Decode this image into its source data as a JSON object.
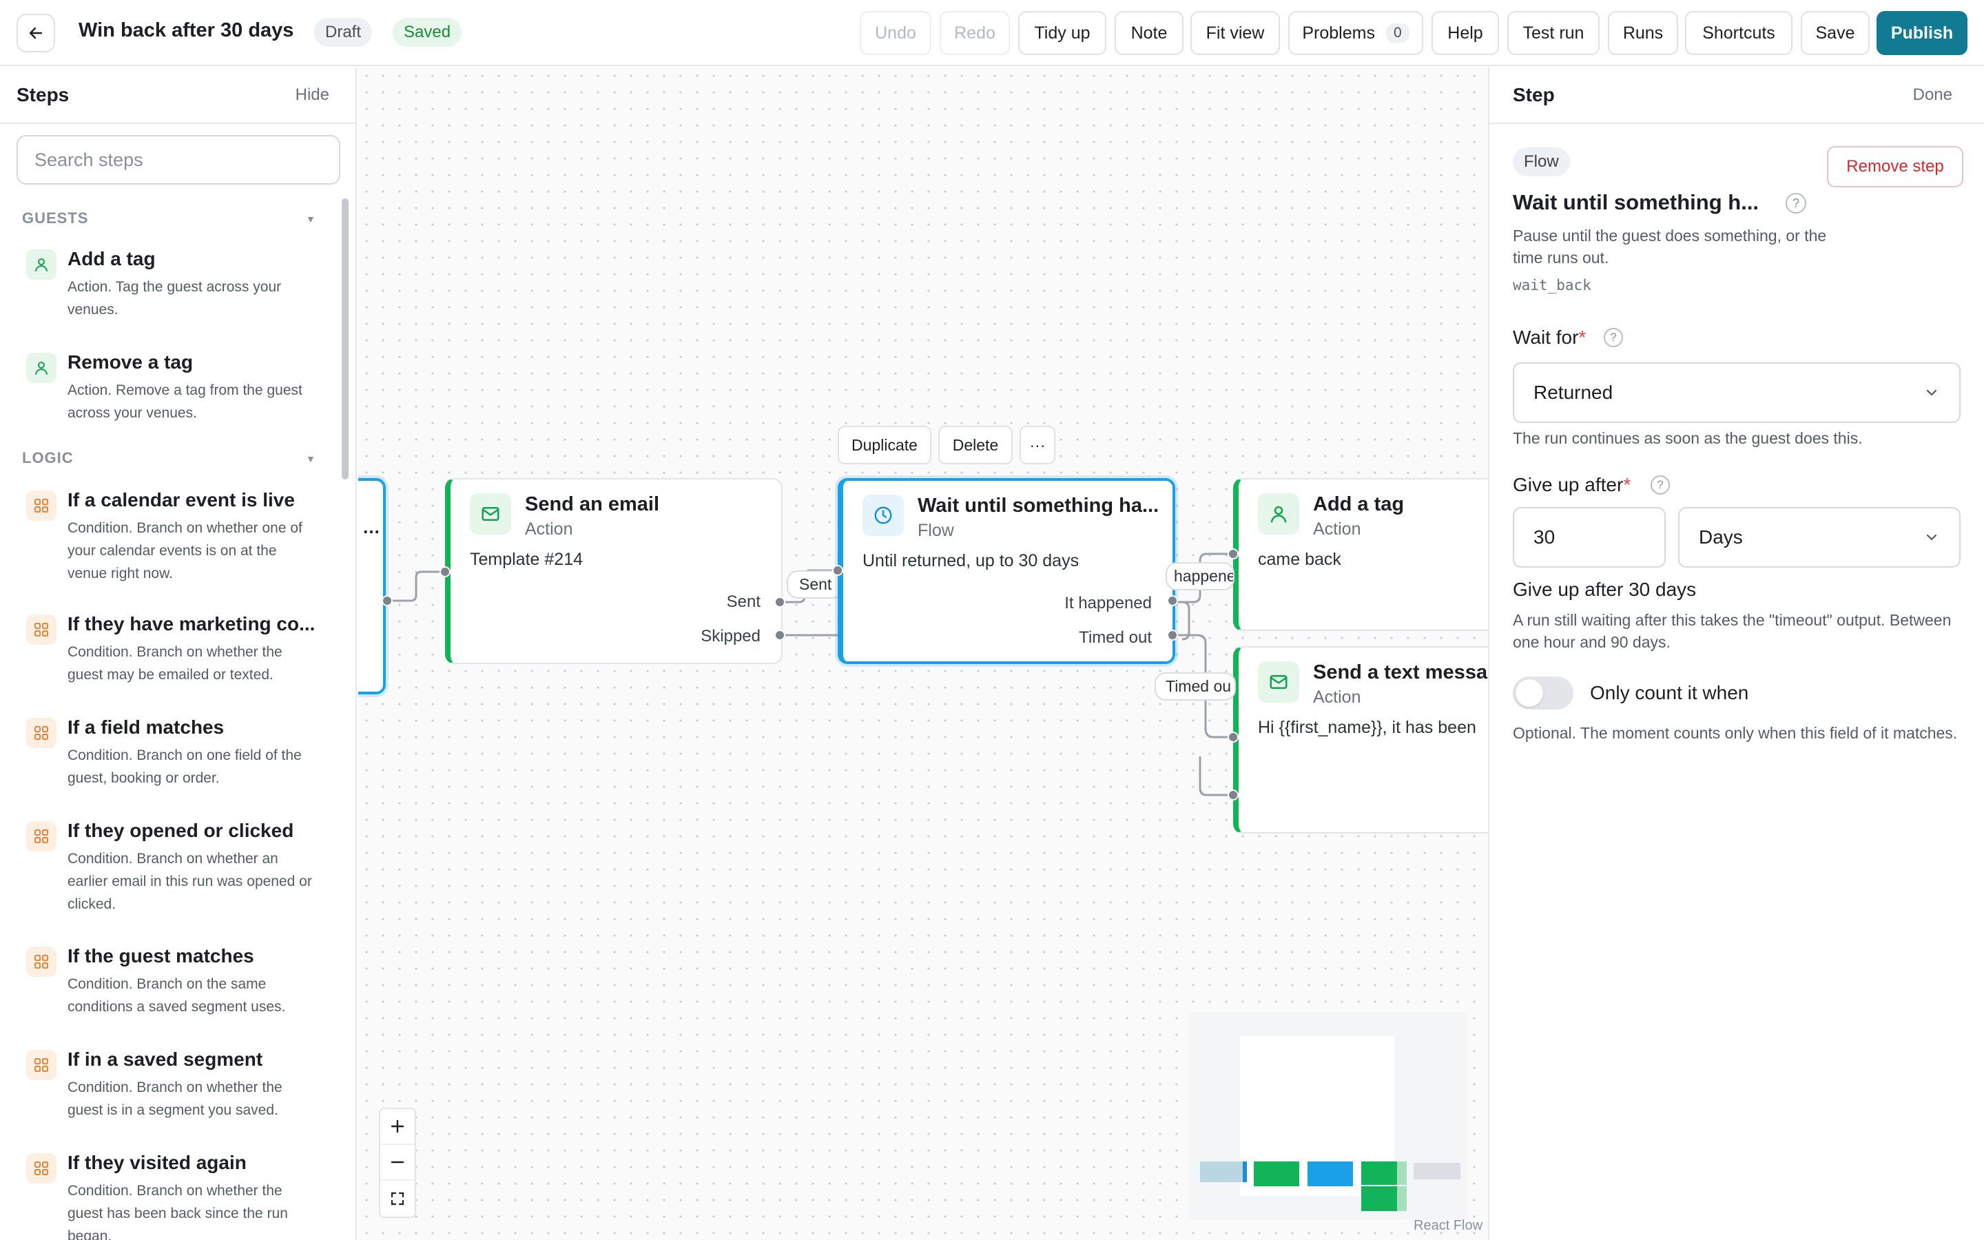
{
  "header": {
    "title": "Win back after 30 days",
    "status_draft": "Draft",
    "status_saved": "Saved",
    "buttons": {
      "undo": "Undo",
      "redo": "Redo",
      "tidy": "Tidy up",
      "note": "Note",
      "fit": "Fit view",
      "problems": "Problems",
      "problems_count": "0",
      "help": "Help",
      "test_run": "Test run",
      "runs": "Runs",
      "shortcuts": "Shortcuts",
      "save": "Save",
      "publish": "Publish"
    }
  },
  "sidebar": {
    "title": "Steps",
    "hide": "Hide",
    "search_placeholder": "Search steps",
    "sections": [
      {
        "label": "GUESTS",
        "items": [
          {
            "name": "Add a tag",
            "desc": "Action. Tag the guest across your venues."
          },
          {
            "name": "Remove a tag",
            "desc": "Action. Remove a tag from the guest across your venues."
          }
        ]
      },
      {
        "label": "LOGIC",
        "items": [
          {
            "name": "If a calendar event is live",
            "desc": "Condition. Branch on whether one of your calendar events is on at the venue right now."
          },
          {
            "name": "If they have marketing co...",
            "desc": "Condition. Branch on whether the guest may be emailed or texted."
          },
          {
            "name": "If a field matches",
            "desc": "Condition. Branch on one field of the guest, booking or order."
          },
          {
            "name": "If they opened or clicked",
            "desc": "Condition. Branch on whether an earlier email in this run was opened or clicked."
          },
          {
            "name": "If the guest matches",
            "desc": "Condition. Branch on the same conditions a saved segment uses."
          },
          {
            "name": "If in a saved segment",
            "desc": "Condition. Branch on whether the guest is in a segment you saved."
          },
          {
            "name": "If they visited again",
            "desc": "Condition. Branch on whether the guest has been back since the run began."
          }
        ]
      }
    ]
  },
  "canvas": {
    "toolbar": {
      "duplicate": "Duplicate",
      "delete": "Delete",
      "more": "···"
    },
    "nodes": {
      "email": {
        "title": "Send an email",
        "kind": "Action",
        "body": "Template #214",
        "port_sent": "Sent",
        "port_skipped": "Skipped"
      },
      "wait": {
        "title": "Wait until something ha...",
        "kind": "Flow",
        "body": "Until returned, up to 30 days",
        "port_happened": "It happened",
        "port_timeout": "Timed out"
      },
      "tag": {
        "title": "Add a tag",
        "kind": "Action",
        "body": "came back"
      },
      "sms": {
        "title": "Send a text messag",
        "kind": "Action",
        "body": "Hi {{first_name}}, it has been"
      }
    },
    "edge_labels": {
      "sent": "Sent",
      "happened": "happened",
      "timed_out": "Timed ou"
    },
    "attribution": "React Flow"
  },
  "panel": {
    "title": "Step",
    "done": "Done",
    "badge": "Flow",
    "remove": "Remove step",
    "step_title": "Wait until something h...",
    "desc": "Pause until the guest does something, or the time runs out.",
    "code": "wait_back",
    "wait_for_label": "Wait for",
    "wait_for_value": "Returned",
    "wait_for_hint": "The run continues as soon as the guest does this.",
    "give_up_label": "Give up after",
    "give_up_value": "30",
    "give_up_unit": "Days",
    "give_up_summary": "Give up after 30 days",
    "give_up_hint": "A run still waiting after this takes the \"timeout\" output. Between one hour and 90 days.",
    "toggle_label": "Only count it when",
    "toggle_on": false,
    "toggle_hint": "Optional. The moment counts only when this field of it matches."
  },
  "colors": {
    "accent": "#137a93",
    "action": "#12b459",
    "selected": "#1aa0e6",
    "danger": "#d12b2b"
  }
}
